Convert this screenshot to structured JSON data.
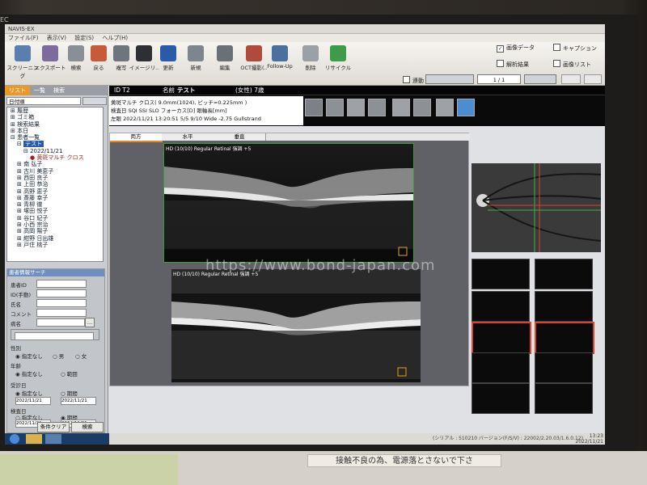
{
  "window": {
    "title": "NAVIS-EX",
    "bezel_brand": "EC"
  },
  "menu": [
    "ファイル(F)",
    "表示(V)",
    "設定(S)",
    "ヘルプ(H)"
  ],
  "toolbar": {
    "buttons": [
      {
        "label": "スクリーニング",
        "icon": "screen-icon"
      },
      {
        "label": "エクスポート",
        "icon": "export-icon"
      },
      {
        "label": "検索",
        "icon": "search-icon"
      },
      {
        "label": "戻る",
        "icon": "back-icon"
      },
      {
        "label": "複写",
        "icon": "copy-icon"
      },
      {
        "label": "イメージリ..",
        "icon": "image-list-icon"
      },
      {
        "label": "更新",
        "icon": "refresh-icon"
      },
      {
        "label": "新規",
        "icon": "new-icon"
      },
      {
        "label": "編集",
        "icon": "edit-icon"
      },
      {
        "label": "OCT撮影(..",
        "icon": "oct-capture-icon"
      },
      {
        "label": "Follow-Up",
        "icon": "follow-up-icon"
      },
      {
        "label": "削除",
        "icon": "delete-icon"
      },
      {
        "label": "リサイクル",
        "icon": "recycle-icon"
      }
    ],
    "checks": [
      {
        "label": "画像データ",
        "checked": true
      },
      {
        "label": "キャプション",
        "checked": false
      },
      {
        "label": "解析結果",
        "checked": false
      },
      {
        "label": "画像リスト",
        "checked": false
      }
    ],
    "page": "1 / 1",
    "link": "連動"
  },
  "left_panel": {
    "tabs": [
      "リスト",
      "一覧",
      "検索"
    ],
    "date_label": "日付順",
    "tree": [
      "履歴",
      "ゴミ箱",
      "検索結果",
      "本日",
      "患者一覧",
      "テスト",
      "2022/11/21",
      "黄斑マルチ クロス",
      "南 弘子",
      "古川 美恵子",
      "西田 良子",
      "上田 恭治",
      "高野 恵子",
      "斎藤 幸子",
      "青柳 徹",
      "塚田 悦子",
      "谷口 紀子",
      "小西 宗治",
      "高岡 陽子",
      "紺野 日出雄",
      "戸住 桃子"
    ],
    "search_title": "患者情報サーチ",
    "search_fields": [
      "患者ID",
      "ID(手動)",
      "氏名",
      "コメント",
      "病名"
    ],
    "section_sex": "性別",
    "sex_options": [
      "指定なし",
      "男",
      "女"
    ],
    "section_age": "年齢",
    "age_options": [
      "指定なし",
      "範囲"
    ],
    "section_visit": "受診日",
    "visit_options": [
      "指定なし",
      "期間"
    ],
    "section_exam": "検査日",
    "exam_options": [
      "指定なし",
      "期間"
    ],
    "date_from": "2022/11/21",
    "date_to": "2022/11/21",
    "btn_clear": "条件クリア",
    "btn_search": "検索"
  },
  "patient": {
    "id": "ID T2",
    "name_label": "名前",
    "name": "テスト",
    "sex_age": "(女性) 7歳"
  },
  "exam_info": {
    "line1": "黄斑マルチ クロス( 9.0mm(1024), ピッチ=0.225mm )",
    "line2": "検査日     SQI  SSI  SLO  フォーカス[D]  眼軸長[mm]",
    "line3": "左眼  2022/11/21 13:20:51  5/5  9/10  Wide  -2.75  Gullstrand"
  },
  "viewer": {
    "tabs": [
      "両方",
      "水平",
      "垂直"
    ],
    "scan1_label": "HD (10/10) Regular Retinal 強調 +5",
    "scan2_label": "HD (10/10) Regular Retinal 強調 +5"
  },
  "watermark": "https://www.bond-japan.com",
  "status": {
    "serial": "(シリアル : 510210  バージョン(F/S/V) : 22002/2.20.03/1.6.0.12)",
    "time": "13:23",
    "date": "2022/11/21"
  },
  "sticker": "接触不良の為、電源落とさないで下さ",
  "colors": {
    "accent_red": "#e04030",
    "scan_green": "#3a9a3a",
    "tree_bg": "#ffffff"
  }
}
